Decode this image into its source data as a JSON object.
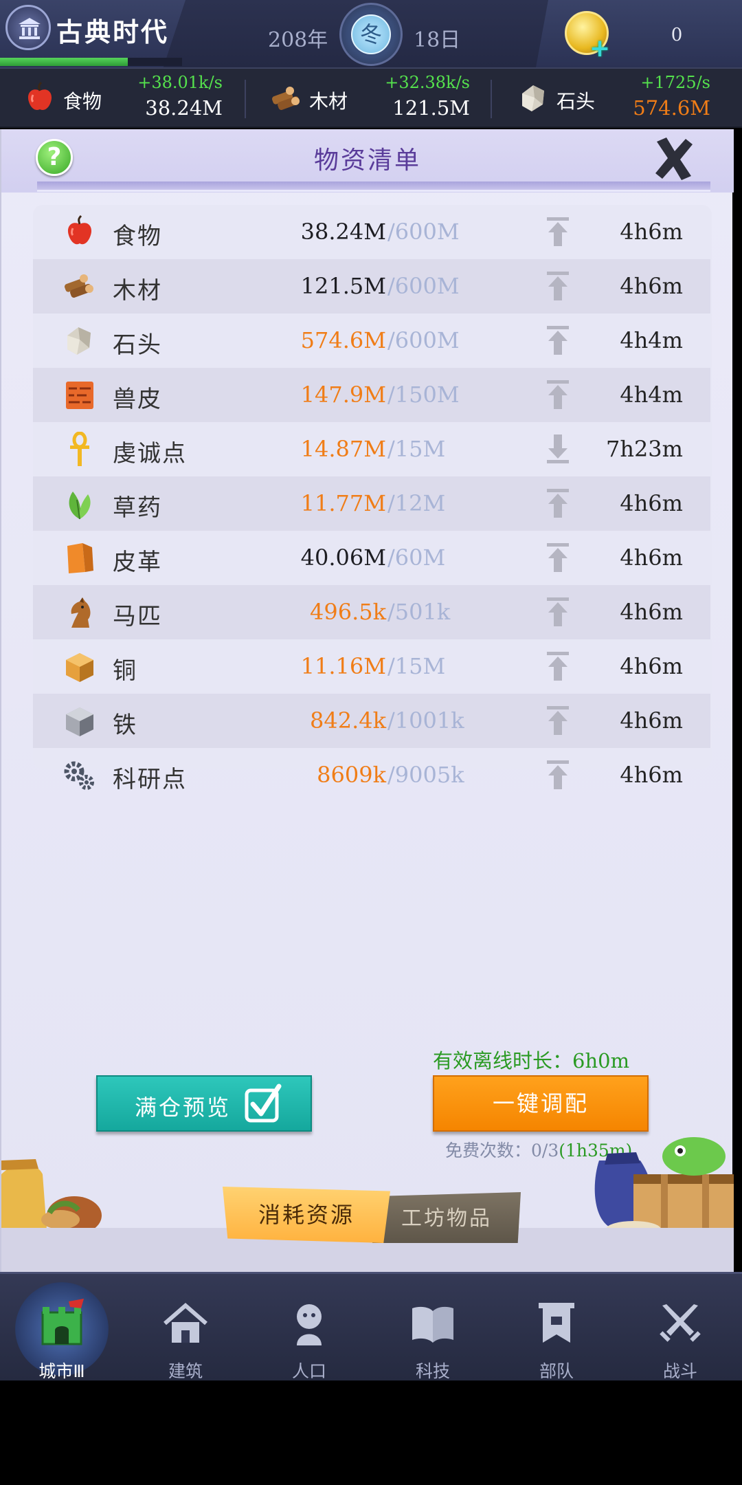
{
  "header": {
    "era_name": "古典时代",
    "era_progress": 0.7,
    "year": "208年",
    "season": "冬",
    "day": "18日",
    "gold_count": "0"
  },
  "topbar_resources": [
    {
      "icon": "apple-icon",
      "name": "食物",
      "rate": "+38.01k/s",
      "amount": "38.24M",
      "amount_color": "#ffffff"
    },
    {
      "icon": "wood-icon",
      "name": "木材",
      "rate": "+32.38k/s",
      "amount": "121.5M",
      "amount_color": "#ffffff"
    },
    {
      "icon": "stone-icon",
      "name": "石头",
      "rate": "+1725/s",
      "amount": "574.6M",
      "amount_color": "#f07d17"
    }
  ],
  "panel": {
    "title": "物资清单",
    "help_label": "?"
  },
  "resources": [
    {
      "icon": "apple-icon",
      "name": "食物",
      "amount": "38.24M",
      "cap": "/600M",
      "status": "ok",
      "arrow": "up",
      "time": "4h6m"
    },
    {
      "icon": "wood-icon",
      "name": "木材",
      "amount": "121.5M",
      "cap": "/600M",
      "status": "ok",
      "arrow": "up",
      "time": "4h6m"
    },
    {
      "icon": "stone-icon",
      "name": "石头",
      "amount": "574.6M",
      "cap": "/600M",
      "status": "warn",
      "arrow": "up",
      "time": "4h4m"
    },
    {
      "icon": "hide-icon",
      "name": "兽皮",
      "amount": "147.9M",
      "cap": "/150M",
      "status": "warn",
      "arrow": "up",
      "time": "4h4m"
    },
    {
      "icon": "ankh-icon",
      "name": "虔诚点",
      "amount": "14.87M",
      "cap": "/15M",
      "status": "warn",
      "arrow": "down",
      "time": "7h23m"
    },
    {
      "icon": "herb-icon",
      "name": "草药",
      "amount": "11.77M",
      "cap": "/12M",
      "status": "warn",
      "arrow": "up",
      "time": "4h6m"
    },
    {
      "icon": "leather-icon",
      "name": "皮革",
      "amount": "40.06M",
      "cap": "/60M",
      "status": "ok",
      "arrow": "up",
      "time": "4h6m"
    },
    {
      "icon": "horse-icon",
      "name": "马匹",
      "amount": "496.5k",
      "cap": "/501k",
      "status": "warn",
      "arrow": "up",
      "time": "4h6m"
    },
    {
      "icon": "copper-icon",
      "name": "铜",
      "amount": "11.16M",
      "cap": "/15M",
      "status": "warn",
      "arrow": "up",
      "time": "4h6m"
    },
    {
      "icon": "iron-icon",
      "name": "铁",
      "amount": "842.4k",
      "cap": "/1001k",
      "status": "warn",
      "arrow": "up",
      "time": "4h6m"
    },
    {
      "icon": "gears-icon",
      "name": "科研点",
      "amount": "8609k",
      "cap": "/9005k",
      "status": "warn",
      "arrow": "up",
      "time": "4h6m"
    }
  ],
  "actions": {
    "offline_label": "有效离线时长：6h0m",
    "preview_label": "满仓预览",
    "assign_label": "一键调配",
    "free_label": "免费次数：0/3",
    "free_cooldown": "(1h35m)"
  },
  "subtabs": {
    "active": "消耗资源",
    "inactive": "工坊物品"
  },
  "nav": [
    {
      "icon": "castle-icon",
      "label": "城市Ⅲ",
      "active": true
    },
    {
      "icon": "house-icon",
      "label": "建筑",
      "active": false
    },
    {
      "icon": "person-icon",
      "label": "人口",
      "active": false
    },
    {
      "icon": "book-icon",
      "label": "科技",
      "active": false
    },
    {
      "icon": "banner-icon",
      "label": "部队",
      "active": false
    },
    {
      "icon": "swords-icon",
      "label": "战斗",
      "active": false
    }
  ],
  "colors": {
    "warn": "#f07d17",
    "ok": "#1d1d22",
    "cap": "#a8b4d6",
    "rate_green": "#55e24d",
    "accent_purple": "#5a3c9a",
    "teal_button": "#1fb8ad",
    "orange_button": "#f88c05"
  }
}
